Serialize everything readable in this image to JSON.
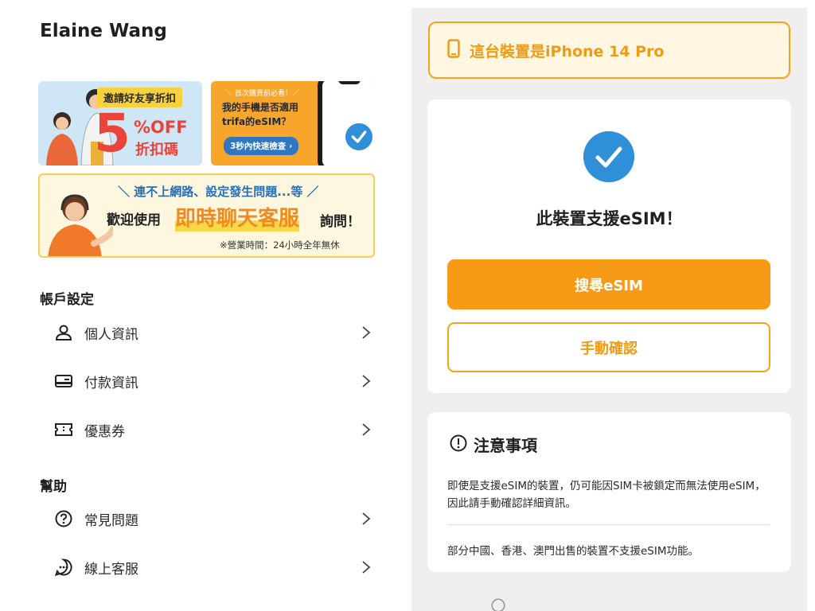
{
  "user": {
    "name": "Elaine Wang"
  },
  "banners": {
    "invite": {
      "tag": "邀請好友享折扣",
      "big_number": "5",
      "off": "%OFF",
      "code": "折扣碼"
    },
    "check": {
      "small": "＼ 首次購買前必看！／",
      "title": "我的手機是否適用trifa的eSIM？",
      "button": "3秒內快速檢查 ›"
    },
    "chat": {
      "top": "＼ 連不上網路、設定發生問題...等 ／",
      "welcome": "歡迎使用",
      "highlight": "即時聊天客服",
      "ask": "詢問！",
      "hours": "※營業時間：24小時全年無休"
    }
  },
  "sections": {
    "account": {
      "title": "帳戶設定",
      "items": [
        {
          "label": "個人資訊",
          "icon": "person-icon"
        },
        {
          "label": "付款資訊",
          "icon": "card-icon"
        },
        {
          "label": "優惠券",
          "icon": "coupon-icon"
        }
      ]
    },
    "help": {
      "title": "幫助",
      "items": [
        {
          "label": "常見問題",
          "icon": "question-icon"
        },
        {
          "label": "線上客服",
          "icon": "chat-icon"
        }
      ]
    }
  },
  "device": {
    "text": "這台裝置是iPhone 14 Pro",
    "icon": "phone-icon"
  },
  "support": {
    "title": "此裝置支援eSIM！",
    "primary_button": "搜尋eSIM",
    "secondary_button": "手動確認"
  },
  "notes": {
    "title": "注意事項",
    "paragraph1": "即使是支援eSIM的裝置，仍可能因SIM卡被鎖定而無法使用eSIM，因此請手動確認詳細資訊。",
    "paragraph2": "部分中國、香港、澳門出售的裝置不支援eSIM功能。"
  },
  "colors": {
    "accent": "#f79a15",
    "blue": "#2f8fd8",
    "panel_bg": "#f0eeee"
  }
}
